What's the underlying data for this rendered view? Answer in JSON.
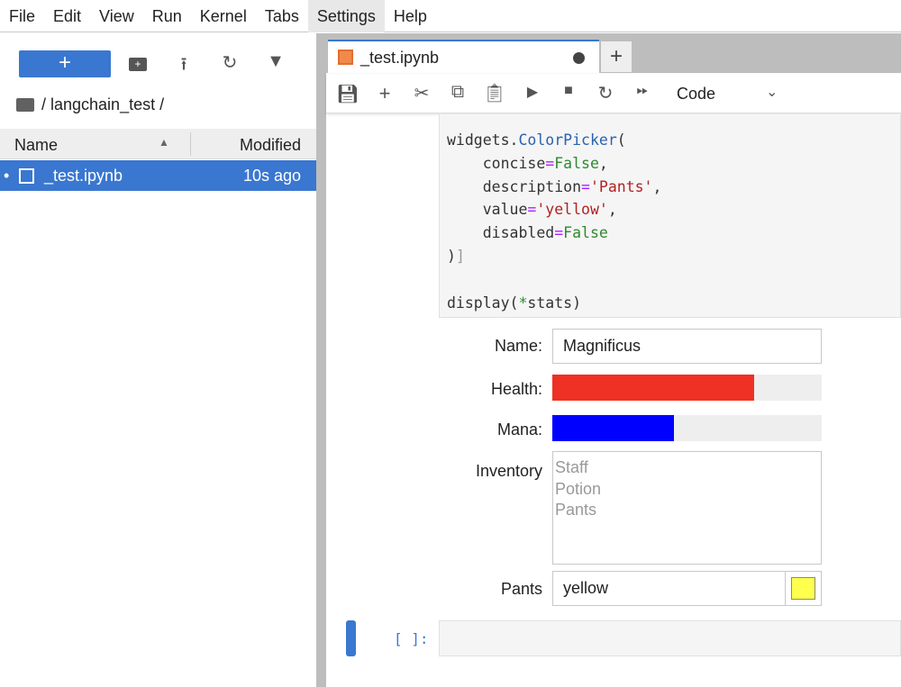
{
  "menu": [
    "File",
    "Edit",
    "View",
    "Run",
    "Kernel",
    "Tabs",
    "Settings",
    "Help"
  ],
  "filebrowser": {
    "new_label": "+",
    "path": "/ langchain_test /",
    "col_name": "Name",
    "col_modified": "Modified",
    "files": [
      {
        "name": "_test.ipynb",
        "modified": "10s ago",
        "running": "•"
      }
    ]
  },
  "notebook": {
    "tab_title": "_test.ipynb",
    "cell_type": "Code",
    "prompt": "[ ]:",
    "code": {
      "l1a": "widgets.",
      "l1b": "ColorPicker",
      "l1c": "(",
      "l2a": "    concise",
      "l2b": "=",
      "l2c": "False",
      "l2d": ",",
      "l3a": "    description",
      "l3b": "=",
      "l3c": "'Pants'",
      "l3d": ",",
      "l4a": "    value",
      "l4b": "=",
      "l4c": "'yellow'",
      "l4d": ",",
      "l5a": "    disabled",
      "l5b": "=",
      "l5c": "False",
      "l6a": ")",
      "l6b": "]",
      "l8a": "display(",
      "l8b": "*",
      "l8c": "stats)"
    }
  },
  "widgets": {
    "name": {
      "label": "Name:",
      "value": "Magnificus"
    },
    "health": {
      "label": "Health:",
      "fraction": 0.75,
      "color": "#ee3124"
    },
    "mana": {
      "label": "Mana:",
      "fraction": 0.45,
      "color": "#0000ff"
    },
    "inventory": {
      "label": "Inventory",
      "options": [
        "Staff",
        "Potion",
        "Pants"
      ]
    },
    "pants": {
      "label": "Pants",
      "value": "yellow",
      "swatch": "#ffff4d"
    }
  },
  "colors": {
    "accent": "#3a77d0"
  }
}
